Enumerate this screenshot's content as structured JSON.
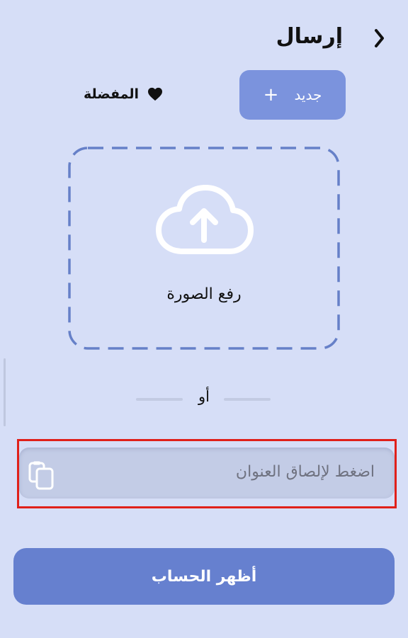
{
  "header": {
    "title": "إرسال"
  },
  "toolbar": {
    "new_label": "جديد",
    "new_icon": "plus-icon",
    "favorites_label": "المفضلة",
    "favorites_icon": "heart-icon"
  },
  "upload": {
    "label": "رفع الصورة",
    "icon": "cloud-upload-icon"
  },
  "divider": {
    "or_text": "أو"
  },
  "paste": {
    "placeholder": "اضغط لإلصاق العنوان",
    "icon": "clipboard-icon"
  },
  "actions": {
    "show_account_label": "أظهر الحساب"
  },
  "colors": {
    "background": "#d6def7",
    "accent": "#6680cf",
    "new_button": "#7b93dd",
    "highlight_border": "#e0201a"
  }
}
